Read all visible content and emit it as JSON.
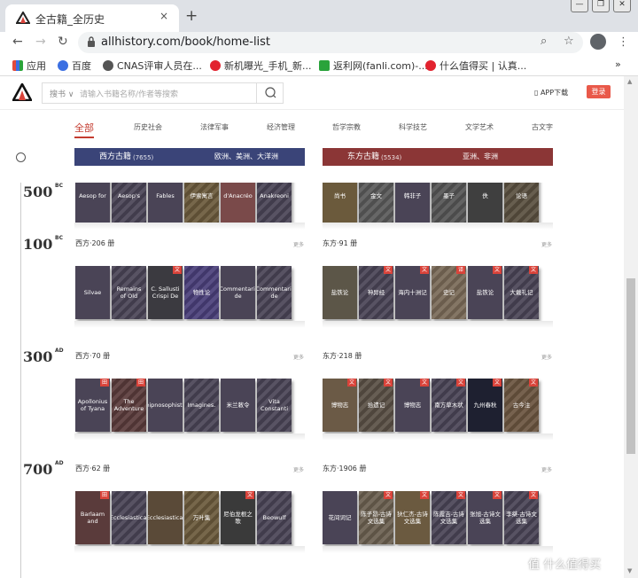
{
  "browser": {
    "tab_title": "全古籍_全历史",
    "tab_close": "×",
    "new_tab": "+",
    "url": "allhistory.com/book/home-list",
    "window_buttons": [
      "—",
      "❐",
      "✕"
    ],
    "bookmarks": [
      {
        "label": "应用",
        "color": "#e24a3b"
      },
      {
        "label": "百度",
        "color": "#3b6fe2"
      },
      {
        "label": "CNAS评审人员在...",
        "color": "#555555"
      },
      {
        "label": "新机曝光_手机_新...",
        "color": "#e2232f"
      },
      {
        "label": "返利网(fanli.com)-...",
        "color": "#2aa33b"
      },
      {
        "label": "什么值得买 | 认真...",
        "color": "#e2232f"
      }
    ],
    "more_bookmarks": "»"
  },
  "site": {
    "search_category": "搜书 ∨",
    "search_placeholder": "请输入书籍名称/作者等搜索",
    "app_download": "APP下载",
    "login": "登录"
  },
  "categories": [
    "全部",
    "历史社会",
    "法律军事",
    "经济管理",
    "哲学宗教",
    "科学技艺",
    "文学艺术",
    "古文字"
  ],
  "regions": {
    "west": {
      "name": "西方古籍",
      "count": "(7655)",
      "sub": "欧洲、美洲、大洋洲"
    },
    "east": {
      "name": "东方古籍",
      "count": "(5534)",
      "sub": "亚洲、非洲"
    }
  },
  "more_label": "更多",
  "era0": {
    "year": "500",
    "suffix": "BC",
    "west_books": [
      {
        "title": "Aesop for",
        "color": "#4a4456",
        "badge": ""
      },
      {
        "title": "Aesop's",
        "color": "#4a4456",
        "badge": ""
      },
      {
        "title": "Fables",
        "color": "#4a4456",
        "badge": ""
      },
      {
        "title": "伊索寓言",
        "color": "#6b5a3c",
        "badge": ""
      },
      {
        "title": "d'Anacréo",
        "color": "#7a4a4a",
        "badge": ""
      },
      {
        "title": "Anakreoni",
        "color": "#4a4456",
        "badge": ""
      }
    ],
    "east_books": [
      {
        "title": "尚书",
        "color": "#6b5a3c",
        "badge": ""
      },
      {
        "title": "金文",
        "color": "#5a5a5a",
        "badge": ""
      },
      {
        "title": "韩非子",
        "color": "#4a4456",
        "badge": ""
      },
      {
        "title": "墨子",
        "color": "#555555",
        "badge": ""
      },
      {
        "title": "佚",
        "color": "#3f3f3f",
        "badge": ""
      },
      {
        "title": "论语",
        "color": "#5a5040",
        "badge": ""
      }
    ]
  },
  "era1": {
    "year": "100",
    "suffix": "BC",
    "west_label": "西方·206 册",
    "east_label": "东方·91 册",
    "west_books": [
      {
        "title": "Silvae",
        "color": "#4a4456",
        "badge": ""
      },
      {
        "title": "Remains of Old",
        "color": "#4a4456",
        "badge": ""
      },
      {
        "title": "C. Sallusti Crispi De",
        "color": "#3b3a40",
        "badge": "文"
      },
      {
        "title": "物性论",
        "color": "#4a3f7a",
        "badge": ""
      },
      {
        "title": "Commentarii de",
        "color": "#4a4456",
        "badge": ""
      },
      {
        "title": "Commentarii de",
        "color": "#4a4456",
        "badge": ""
      }
    ],
    "east_books": [
      {
        "title": "盐铁论",
        "color": "#5c5648",
        "badge": ""
      },
      {
        "title": "神异经",
        "color": "#4a4456",
        "badge": "文"
      },
      {
        "title": "海内十洲记",
        "color": "#4a4456",
        "badge": "文"
      },
      {
        "title": "史记",
        "color": "#7a6a58",
        "badge": "译"
      },
      {
        "title": "盐铁论",
        "color": "#4a4456",
        "badge": "文"
      },
      {
        "title": "大戴礼记",
        "color": "#4a4456",
        "badge": "文"
      }
    ]
  },
  "era2": {
    "year": "300",
    "suffix": "AD",
    "west_label": "西方·70 册",
    "east_label": "东方·218 册",
    "west_books": [
      {
        "title": "Apollonius of Tyana",
        "color": "#4a4456",
        "badge": "田"
      },
      {
        "title": "The Adventure",
        "color": "#5a3b3b",
        "badge": "田"
      },
      {
        "title": "Deipnosophistae",
        "color": "#4a4456",
        "badge": ""
      },
      {
        "title": "Imagines.",
        "color": "#4a4456",
        "badge": ""
      },
      {
        "title": "米兰敕令",
        "color": "#4a4456",
        "badge": ""
      },
      {
        "title": "Vita Constanti",
        "color": "#4a4456",
        "badge": ""
      }
    ],
    "east_books": [
      {
        "title": "博物志",
        "color": "#6b5a46",
        "badge": "文"
      },
      {
        "title": "拾遗记",
        "color": "#5a5045",
        "badge": "文"
      },
      {
        "title": "博物志",
        "color": "#4a4456",
        "badge": "文"
      },
      {
        "title": "南方草木状",
        "color": "#4a4456",
        "badge": "文"
      },
      {
        "title": "九州春秋",
        "color": "#1e2030",
        "badge": "文"
      },
      {
        "title": "古今注",
        "color": "#6b5540",
        "badge": "文"
      }
    ]
  },
  "era3": {
    "year": "700",
    "suffix": "AD",
    "west_label": "西方·62 册",
    "east_label": "东方·1906 册",
    "west_books": [
      {
        "title": "Barlaam and",
        "color": "#5a3b3b",
        "badge": "田"
      },
      {
        "title": "Ecclesiastical",
        "color": "#4a4456",
        "badge": ""
      },
      {
        "title": "Ecclesiastical",
        "color": "#5a4a38",
        "badge": ""
      },
      {
        "title": "万叶集",
        "color": "#6b5a3c",
        "badge": ""
      },
      {
        "title": "尼伯龙根之歌",
        "color": "#3a3a3a",
        "badge": "文"
      },
      {
        "title": "Beowulf",
        "color": "#4a4456",
        "badge": ""
      }
    ],
    "east_books": [
      {
        "title": "花间词记",
        "color": "#4a4456",
        "badge": ""
      },
      {
        "title": "陈子昂-古诗文选集",
        "color": "#6b6050",
        "badge": "文"
      },
      {
        "title": "狄仁杰-古诗文选集",
        "color": "#6b5a40",
        "badge": "文"
      },
      {
        "title": "陈霞吉-古诗文选集",
        "color": "#4a4456",
        "badge": "文"
      },
      {
        "title": "张旭-古诗文选集",
        "color": "#4a4456",
        "badge": "文"
      },
      {
        "title": "李桀-古诗文选集",
        "color": "#4a4456",
        "badge": "文"
      }
    ]
  },
  "watermark": "值 什么值得买"
}
